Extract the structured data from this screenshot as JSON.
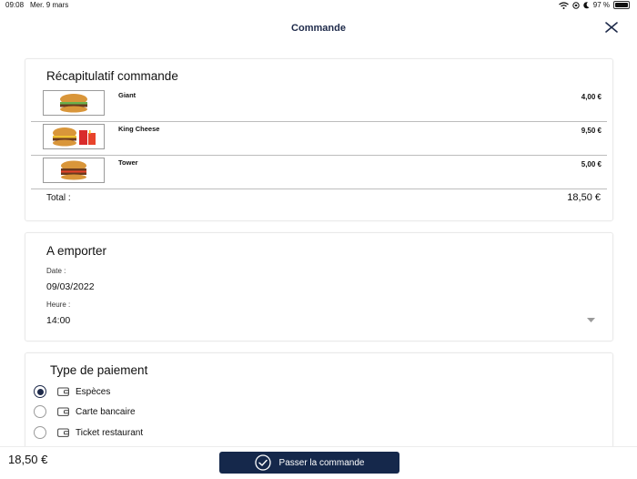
{
  "status_bar": {
    "time": "09:08",
    "date": "Mer. 9 mars",
    "battery": "97 %"
  },
  "nav": {
    "title": "Commande"
  },
  "summary": {
    "title": "Récapitulatif commande",
    "items": [
      {
        "name": "Giant",
        "price": "4,00 €"
      },
      {
        "name": "King Cheese",
        "price": "9,50 €"
      },
      {
        "name": "Tower",
        "price": "5,00 €"
      }
    ],
    "total_label": "Total :",
    "total_value": "18,50 €"
  },
  "pickup": {
    "title": "A emporter",
    "date_label": "Date :",
    "date_value": "09/03/2022",
    "time_label": "Heure :",
    "time_value": "14:00"
  },
  "payment": {
    "title": "Type de paiement",
    "options": [
      {
        "label": "Espèces",
        "selected": true
      },
      {
        "label": "Carte bancaire",
        "selected": false
      },
      {
        "label": "Ticket restaurant",
        "selected": false
      }
    ]
  },
  "footer": {
    "total": "18,50 €",
    "order_button": "Passer la commande"
  },
  "colors": {
    "primary": "#15284b",
    "border": "#e9e9e9"
  }
}
